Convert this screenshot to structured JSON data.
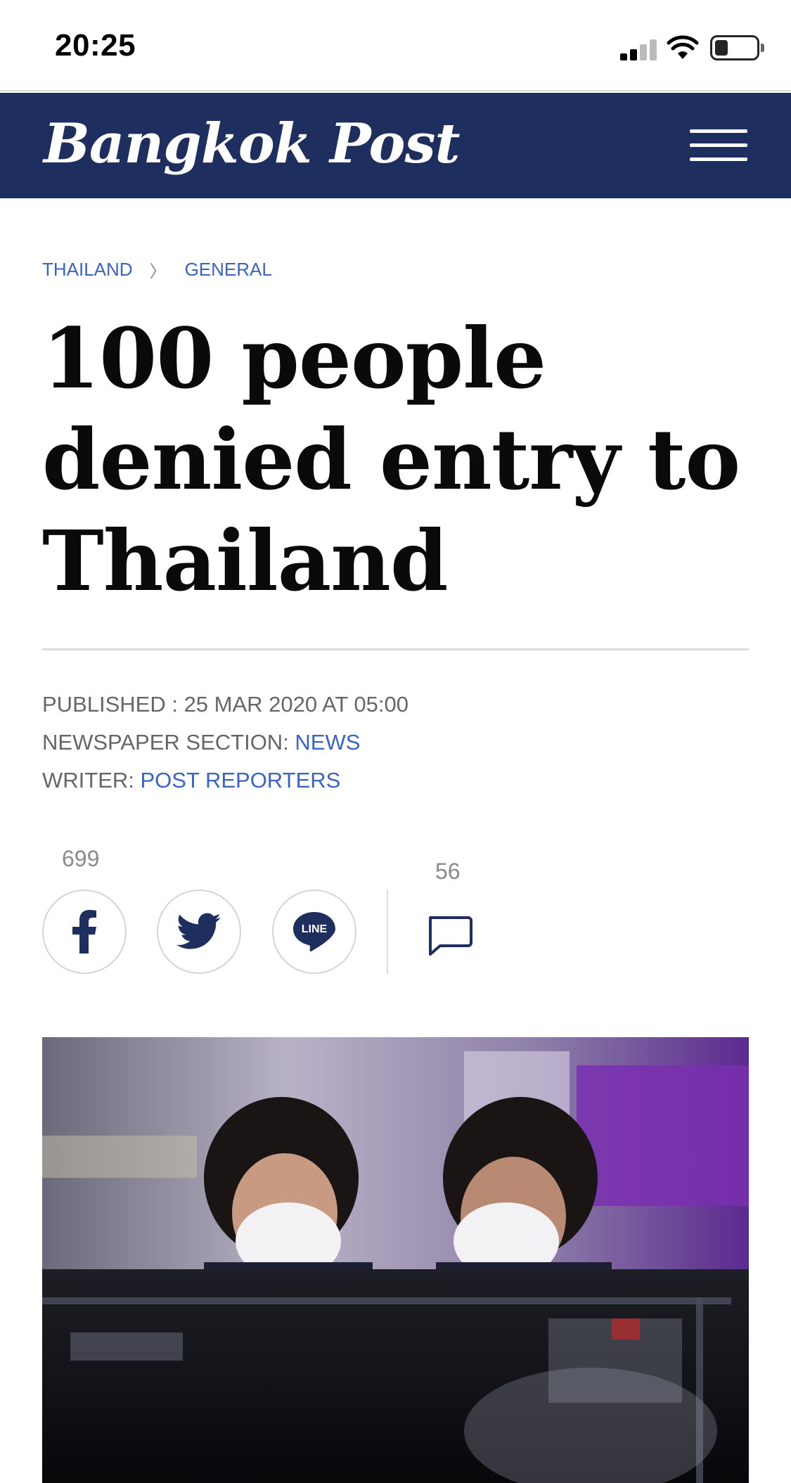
{
  "status_bar": {
    "time": "20:25"
  },
  "header": {
    "logo_text": "Bangkok Post",
    "menu_icon": "hamburger-menu-icon"
  },
  "breadcrumb": {
    "items": [
      "THAILAND",
      "GENERAL"
    ],
    "separator": "〉"
  },
  "article": {
    "headline_lines": [
      "100 people",
      "denied entry to",
      "Thailand"
    ],
    "published_label": "PUBLISHED : ",
    "published_value": "25 MAR 2020 AT 05:00",
    "section_label": "NEWSPAPER SECTION: ",
    "section_value": "NEWS",
    "writer_label": "WRITER: ",
    "writer_value": "POST REPORTERS"
  },
  "share": {
    "share_count": "699",
    "comment_count": "56",
    "line_label": "LINE",
    "icons": [
      "facebook-icon",
      "twitter-icon",
      "line-icon",
      "comment-icon"
    ]
  },
  "colors": {
    "header_bg": "#1d2e5f",
    "link": "#3a63c8",
    "meta_text": "#666666"
  }
}
